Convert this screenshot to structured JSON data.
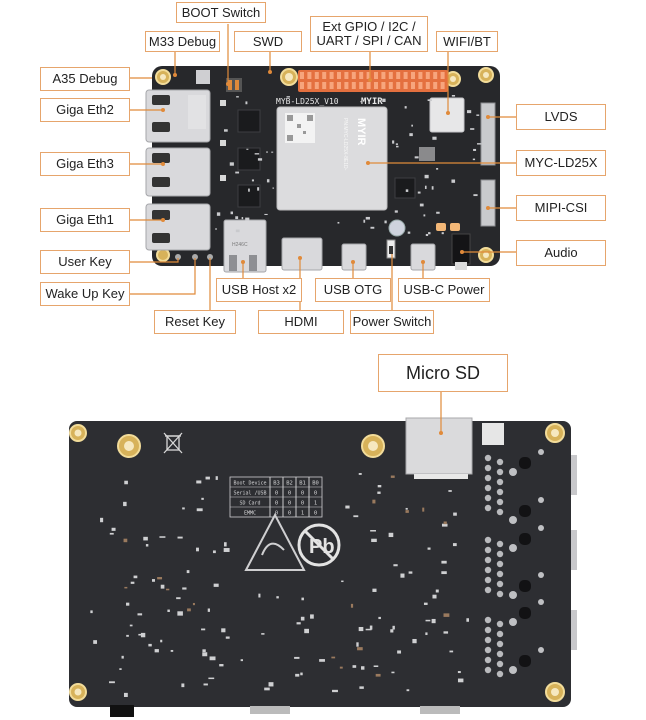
{
  "top_view": {
    "labels": {
      "boot_switch": "BOOT Switch",
      "m33_debug": "M33 Debug",
      "swd": "SWD",
      "ext_gpio": "Ext GPIO / I2C /\nUART / SPI / CAN",
      "ext_gpio_line1": "Ext GPIO / I2C /",
      "ext_gpio_line2": "UART / SPI / CAN",
      "wifi_bt": "WIFI/BT",
      "a35_debug": "A35 Debug",
      "giga_eth2": "Giga Eth2",
      "giga_eth3": "Giga Eth3",
      "giga_eth1": "Giga Eth1",
      "user_key": "User Key",
      "wake_up_key": "Wake Up Key",
      "reset_key": "Reset Key",
      "usb_host": "USB Host x2",
      "hdmi": "HDMI",
      "usb_otg": "USB OTG",
      "power_switch": "Power Switch",
      "usb_c_power": "USB-C Power",
      "lvds": "LVDS",
      "myc_ld25x": "MYC-LD25X",
      "mipi_csi": "MIPI-CSI",
      "audio": "Audio"
    },
    "silkscreen": {
      "board_name": "MYB-LD25X_V10",
      "brand": "MYIR",
      "module_brand": "MYIR",
      "module_pn": "PN:MYC-LD25X-8E1D-",
      "usb_marking": "H246C"
    },
    "colors": {
      "label_border": "#e6a56c",
      "leader_line": "#e08a3a",
      "pcb": "#27282b",
      "gpio_header": "#f08a5a"
    }
  },
  "bottom_view": {
    "labels": {
      "micro_sd": "Micro SD"
    },
    "boot_table": {
      "headers": [
        "Boot Device",
        "B3",
        "B2",
        "B1",
        "B0"
      ],
      "rows": [
        [
          "Serial /USB",
          "0",
          "0",
          "0",
          "0"
        ],
        [
          "SD Card",
          "0",
          "0",
          "0",
          "1"
        ],
        [
          "EMMC",
          "0",
          "0",
          "1",
          "0"
        ]
      ]
    },
    "icons": [
      "weee-bin-icon",
      "esd-warning-icon",
      "lead-free-icon"
    ]
  }
}
